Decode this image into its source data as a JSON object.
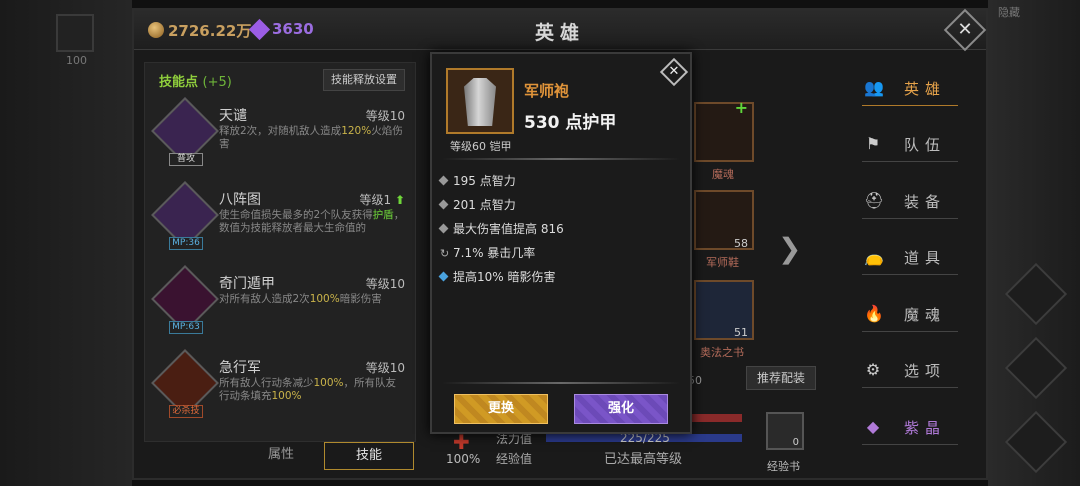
{
  "currency": {
    "gold": "2726.22万",
    "gems": "3630"
  },
  "background": {
    "top_num_1": "100",
    "top_right": "隐藏"
  },
  "window": {
    "title": "英雄"
  },
  "skills": {
    "header": "技能点",
    "points": "(+5)",
    "release_settings": "技能释放设置",
    "items": [
      {
        "name": "天谴",
        "level": "等级10",
        "desc_a": "释放2次，对随机敌人造成",
        "desc_hl": "120%",
        "desc_b": "火焰伤害",
        "badge": "普攻",
        "icon_color": "#6a3a8a"
      },
      {
        "name": "八阵图",
        "level": "等级1",
        "desc_a": "使生命值损失最多的2个队友获得",
        "desc_hl": "护盾",
        "desc_b": "，数值为技能释放者最大生命值的",
        "badge": "MP:36",
        "icon_color": "#6a3a8a"
      },
      {
        "name": "奇门遁甲",
        "level": "等级10",
        "desc_a": "对所有敌人造成2次",
        "desc_hl": "100%",
        "desc_b": "暗影伤害",
        "badge": "MP:63",
        "icon_color": "#5a1a3a"
      },
      {
        "name": "急行军",
        "level": "等级10",
        "desc_a": "所有敌人行动条减少",
        "desc_hl": "100%",
        "desc_b": "，所有队友行动条填充",
        "desc_hl2": "100%",
        "badge": "必杀技",
        "icon_color": "#6a2a1a"
      }
    ],
    "tabs": [
      "属性",
      "技能"
    ]
  },
  "equipment": {
    "soul_label": "魔魂",
    "boots_label": "军师鞋",
    "boots_count": "58",
    "book_label": "奥法之书",
    "book_count": "51",
    "recommend": "推荐配装",
    "mana_label": "法力值",
    "mana_value": "225/225",
    "exp_label": "经验值",
    "max_level": "已达最高等级",
    "pct": "100%",
    "exp_book": "经验书",
    "exp_book_count": "0",
    "partial_num": "50"
  },
  "nav": {
    "items": [
      {
        "label": "英雄",
        "icon": "heroes-icon",
        "glyph": "👥"
      },
      {
        "label": "队伍",
        "icon": "flag-icon",
        "glyph": "⚑"
      },
      {
        "label": "装备",
        "icon": "helmet-icon",
        "glyph": "⛑"
      },
      {
        "label": "道具",
        "icon": "bag-icon",
        "glyph": "👝"
      },
      {
        "label": "魔魂",
        "icon": "flame-icon",
        "glyph": "🔥"
      },
      {
        "label": "选项",
        "icon": "gear-icon",
        "glyph": "⚙"
      },
      {
        "label": "紫晶",
        "icon": "crystal-icon",
        "glyph": "◆"
      }
    ]
  },
  "tooltip": {
    "name": "军师袍",
    "armor": "530 点护甲",
    "level": "等级60 铠甲",
    "stats": [
      {
        "text": "195 点智力",
        "bullet": "diamond"
      },
      {
        "text": "201 点智力",
        "bullet": "diamond"
      },
      {
        "text": "最大伤害值提高 816",
        "bullet": "diamond"
      },
      {
        "text": "7.1% 暴击几率",
        "bullet": "cycle"
      },
      {
        "text": "提高10% 暗影伤害",
        "bullet": "blue-diamond"
      }
    ],
    "replace": "更换",
    "enhance": "强化"
  },
  "colors": {
    "accent_orange": "#e0943a",
    "gold_button": "#d09a24",
    "purple_button": "#7a55c8"
  }
}
